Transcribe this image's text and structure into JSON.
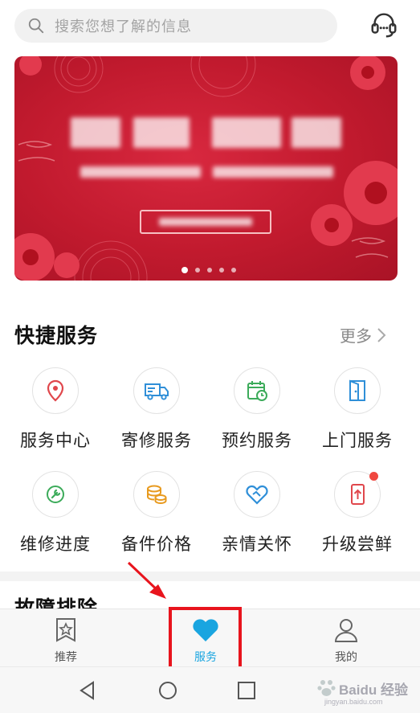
{
  "search": {
    "placeholder": "搜索您想了解的信息",
    "icon": "search-icon"
  },
  "header": {
    "support_icon": "headset-icon"
  },
  "banner": {
    "dots_total": 5,
    "active_index": 0,
    "accent": "#c8192f"
  },
  "quick_services": {
    "title": "快捷服务",
    "more_label": "更多",
    "items": [
      {
        "label": "服务中心",
        "icon": "location-pin-icon",
        "color": "#e0474c"
      },
      {
        "label": "寄修服务",
        "icon": "delivery-truck-icon",
        "color": "#2f8fd8"
      },
      {
        "label": "预约服务",
        "icon": "calendar-clock-icon",
        "color": "#3cab5a"
      },
      {
        "label": "上门服务",
        "icon": "door-icon",
        "color": "#2f8fd8"
      },
      {
        "label": "维修进度",
        "icon": "wrench-icon",
        "color": "#3cab5a"
      },
      {
        "label": "备件价格",
        "icon": "coins-icon",
        "color": "#e89a1e"
      },
      {
        "label": "亲情关怀",
        "icon": "heart-handshake-icon",
        "color": "#2f8fd8"
      },
      {
        "label": "升级尝鲜",
        "icon": "phone-upgrade-icon",
        "color": "#e0474c",
        "badge": true
      }
    ]
  },
  "next_section": {
    "title": "故障排除"
  },
  "tabbar": {
    "items": [
      {
        "label": "推荐",
        "icon": "bookmark-star-icon",
        "active": false
      },
      {
        "label": "服务",
        "icon": "heart-icon",
        "active": true
      },
      {
        "label": "我的",
        "icon": "user-icon",
        "active": false
      }
    ],
    "active_color": "#1aa5e0"
  },
  "watermark": {
    "text": "Baidu 经验",
    "url_text": "jingyan.baidu.com"
  },
  "system_nav": {
    "icons": [
      "back-icon",
      "home-icon",
      "recents-icon"
    ]
  }
}
